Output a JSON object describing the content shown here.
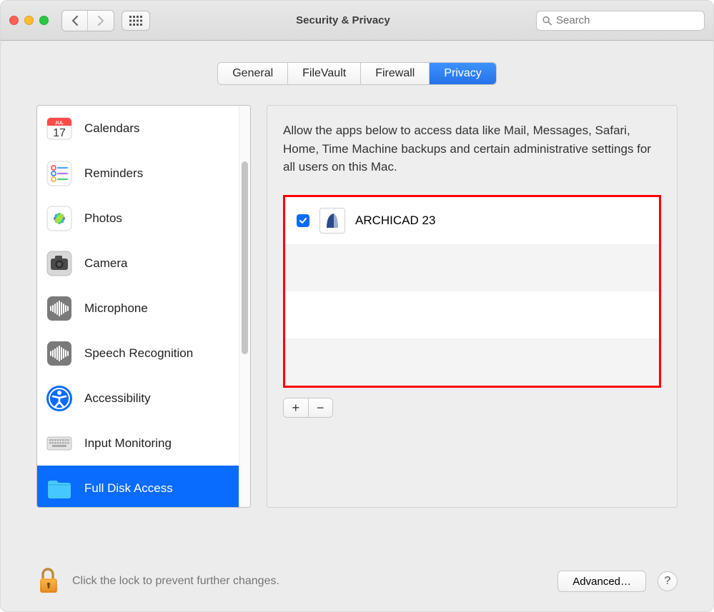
{
  "window": {
    "title": "Security & Privacy"
  },
  "search": {
    "placeholder": "Search"
  },
  "tabs": {
    "items": [
      "General",
      "FileVault",
      "Firewall",
      "Privacy"
    ],
    "active": "Privacy"
  },
  "sidebar": {
    "items": [
      {
        "label": "Calendars",
        "icon": "calendar-icon",
        "selected": false
      },
      {
        "label": "Reminders",
        "icon": "reminders-icon",
        "selected": false
      },
      {
        "label": "Photos",
        "icon": "photos-icon",
        "selected": false
      },
      {
        "label": "Camera",
        "icon": "camera-icon",
        "selected": false
      },
      {
        "label": "Microphone",
        "icon": "microphone-icon",
        "selected": false
      },
      {
        "label": "Speech Recognition",
        "icon": "speech-icon",
        "selected": false
      },
      {
        "label": "Accessibility",
        "icon": "accessibility-icon",
        "selected": false
      },
      {
        "label": "Input Monitoring",
        "icon": "keyboard-icon",
        "selected": false
      },
      {
        "label": "Full Disk Access",
        "icon": "folder-icon",
        "selected": true
      }
    ]
  },
  "detail": {
    "description": "Allow the apps below to access data like Mail, Messages, Safari, Home, Time Machine backups and certain administrative settings for all users on this Mac.",
    "apps": [
      {
        "name": "ARCHICAD 23",
        "checked": true,
        "icon": "archicad-icon"
      }
    ]
  },
  "footer": {
    "lock_text": "Click the lock to prevent further changes.",
    "advanced_label": "Advanced…"
  },
  "buttons": {
    "add": "+",
    "remove": "−"
  }
}
